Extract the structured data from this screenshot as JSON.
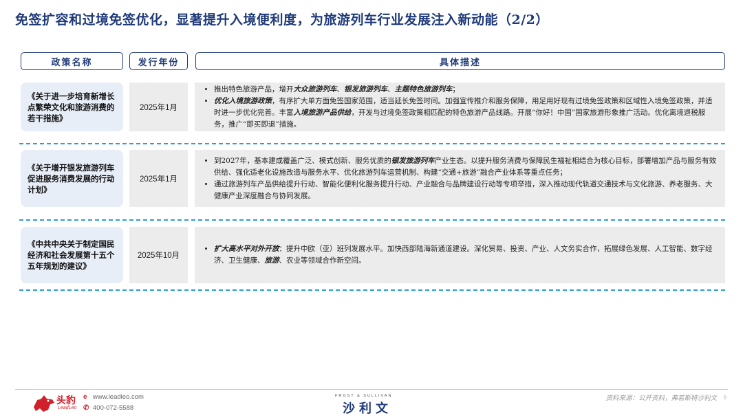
{
  "title": "免签扩容和过境免签优化，显著提升入境便利度，为旅游列车行业发展注入新动能（2/2）",
  "headers": {
    "name": "政策名称",
    "year": "发行年份",
    "desc": "具体描述"
  },
  "rows": [
    {
      "name": "《关于进一步培育新增长点繁荣文化和旅游消费的若干措施》",
      "year": "2025年1月",
      "bullets": [
        [
          {
            "t": "推出特色旅游产品，增开"
          },
          {
            "t": "大众旅游列车",
            "b": true
          },
          {
            "t": "、"
          },
          {
            "t": "银发旅游列车",
            "b": true
          },
          {
            "t": "、"
          },
          {
            "t": "主题特色旅游列车",
            "b": true
          },
          {
            "t": "；"
          }
        ],
        [
          {
            "t": "优化入境旅游政策",
            "b": true
          },
          {
            "t": "，有序扩大单方面免签国家范围，适当延长免签时间。加强宣传推介和服务保障，用足用好现有过境免签政策和区域性入境免签政策，并适时进一步优化完善。丰富"
          },
          {
            "t": "入境旅游产品供给",
            "b": true
          },
          {
            "t": "，开发与过境免签政策相匹配的特色旅游产品线路。开展“你好！中国”国家旅游形象推广活动。优化离境退税服务，推广“即买即退”措施。"
          }
        ]
      ]
    },
    {
      "name": "《关于增开银发旅游列车促进服务消费发展的行动计划》",
      "year": "2025年1月",
      "bullets": [
        [
          {
            "t": "到2027年，基本建成覆盖广泛、模式创新、服务优质的"
          },
          {
            "t": "银发旅游列车",
            "b": true
          },
          {
            "t": "产业生态。以提升服务消费与保障民生福祉相结合为核心目标，部署增加产品与服务有效供给、强化适老化设施改造与服务水平、优化旅游列车运营机制、构建“交通+旅游”融合产业体系等重点任务；"
          }
        ],
        [
          {
            "t": "通过旅游列车产品供给提升行动、智能化便利化服务提升行动、产业融合与品牌建设行动等专项举措，深入推动现代轨道交通技术与文化旅游、养老服务、大健康产业深度融合与协同发展。"
          }
        ]
      ]
    },
    {
      "name": "《中共中央关于制定国民经济和社会发展第十五个五年规划的建议》",
      "year": "2025年10月",
      "bullets": [
        [
          {
            "t": "扩大高水平对外开放",
            "b": true
          },
          {
            "t": "：提升中欧（亚）班列发展水平。加快西部陆海新通道建设。深化贸易、投资、产业、人文务实合作，拓展绿色发展、人工智能、数字经济、卫生健康、"
          },
          {
            "t": "旅游",
            "b": true
          },
          {
            "t": "、农业等领域合作新空间。"
          }
        ]
      ]
    }
  ],
  "footer": {
    "brand_cn": "头豹",
    "brand_en": "LeadLeo",
    "website": "www.leadleo.com",
    "phone": "400-072-5588",
    "fs_small": "FROST & SULLIVAN",
    "fs_big": "沙利文",
    "source": "资料来源：公开资料，弗若斯特沙利文",
    "page": "9"
  }
}
